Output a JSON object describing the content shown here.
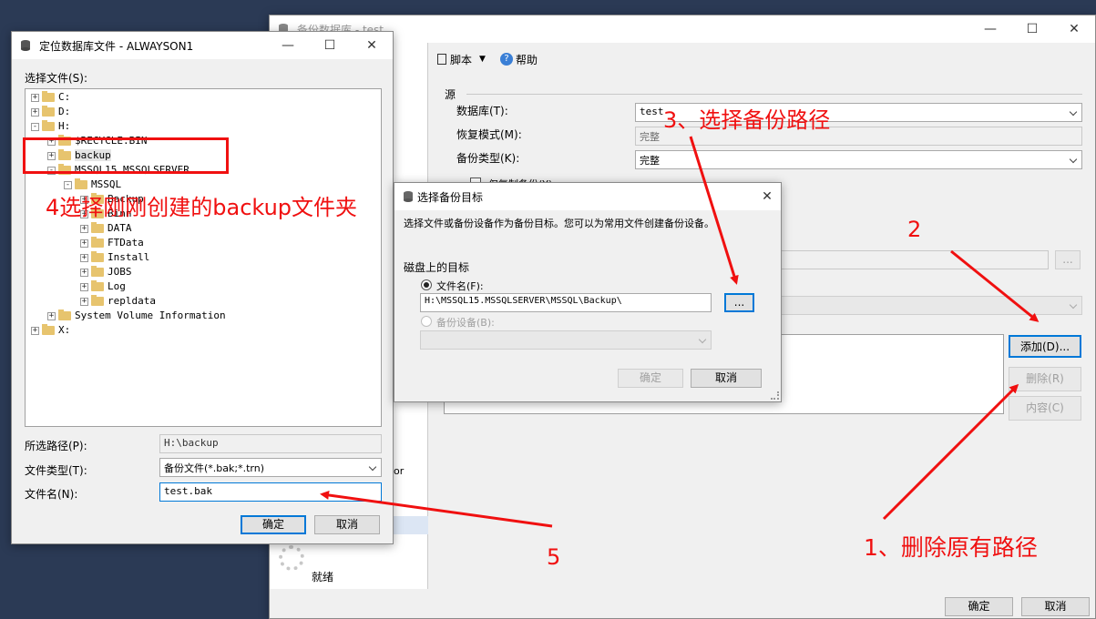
{
  "backup_window": {
    "title": "备份数据库 - test",
    "toolbar": {
      "script": "脚本",
      "help": "帮助"
    },
    "section_source": "源",
    "database_label": "数据库(T):",
    "database_value": "test",
    "recovery_label": "恢复模式(M):",
    "recovery_value": "完整",
    "backup_type_label": "备份类型(K):",
    "backup_type_value": "完整",
    "copy_only_label": "仅复制备份(Y)",
    "partial_label": "or",
    "status_text": "就绪",
    "add_button": "添加(D)...",
    "remove_button": "删除(R)",
    "contents_button": "内容(C)",
    "browse_button": "...",
    "ok_button": "确定",
    "cancel_button": "取消"
  },
  "locate_window": {
    "title": "定位数据库文件 - ALWAYSON1",
    "select_file_label": "选择文件(S):",
    "tree": [
      {
        "label": "C:",
        "indent": 0,
        "pm": "+"
      },
      {
        "label": "D:",
        "indent": 0,
        "pm": "+"
      },
      {
        "label": "H:",
        "indent": 0,
        "pm": "-"
      },
      {
        "label": "$RECYCLE.BIN",
        "indent": 1,
        "pm": "+"
      },
      {
        "label": "backup",
        "indent": 1,
        "pm": "+"
      },
      {
        "label": "MSSQL15.MSSQLSERVER",
        "indent": 1,
        "pm": "-"
      },
      {
        "label": "MSSQL",
        "indent": 2,
        "pm": "-"
      },
      {
        "label": "Backup",
        "indent": 3,
        "pm": "+"
      },
      {
        "label": "Binn",
        "indent": 3,
        "pm": "+"
      },
      {
        "label": "DATA",
        "indent": 3,
        "pm": "+"
      },
      {
        "label": "FTData",
        "indent": 3,
        "pm": "+"
      },
      {
        "label": "Install",
        "indent": 3,
        "pm": "+"
      },
      {
        "label": "JOBS",
        "indent": 3,
        "pm": "+"
      },
      {
        "label": "Log",
        "indent": 3,
        "pm": "+"
      },
      {
        "label": "repldata",
        "indent": 3,
        "pm": "+"
      },
      {
        "label": "System Volume Information",
        "indent": 1,
        "pm": "+"
      },
      {
        "label": "X:",
        "indent": 0,
        "pm": "+"
      }
    ],
    "selected_path_label": "所选路径(P):",
    "selected_path_value": "H:\\backup",
    "file_type_label": "文件类型(T):",
    "file_type_value": "备份文件(*.bak;*.trn)",
    "file_name_label": "文件名(N):",
    "file_name_value": "test.bak",
    "ok_button": "确定",
    "cancel_button": "取消"
  },
  "select_target_window": {
    "title": "选择备份目标",
    "description": "选择文件或备份设备作为备份目标。您可以为常用文件创建备份设备。",
    "disk_target_label": "磁盘上的目标",
    "file_name_radio": "文件名(F):",
    "file_name_value": "H:\\MSSQL15.MSSQLSERVER\\MSSQL\\Backup\\",
    "browse_button": "...",
    "device_radio": "备份设备(B):",
    "ok_button": "确定",
    "cancel_button": "取消"
  },
  "annotations": {
    "step1": "1、删除原有路径",
    "step2": "2",
    "step3": "3、选择备份路径",
    "step4": "4选择刚刚创建的backup文件夹",
    "step5": "5"
  },
  "colors": {
    "annotation_red": "#f01010",
    "desktop": "#2b3a55",
    "accent": "#0078d7"
  }
}
